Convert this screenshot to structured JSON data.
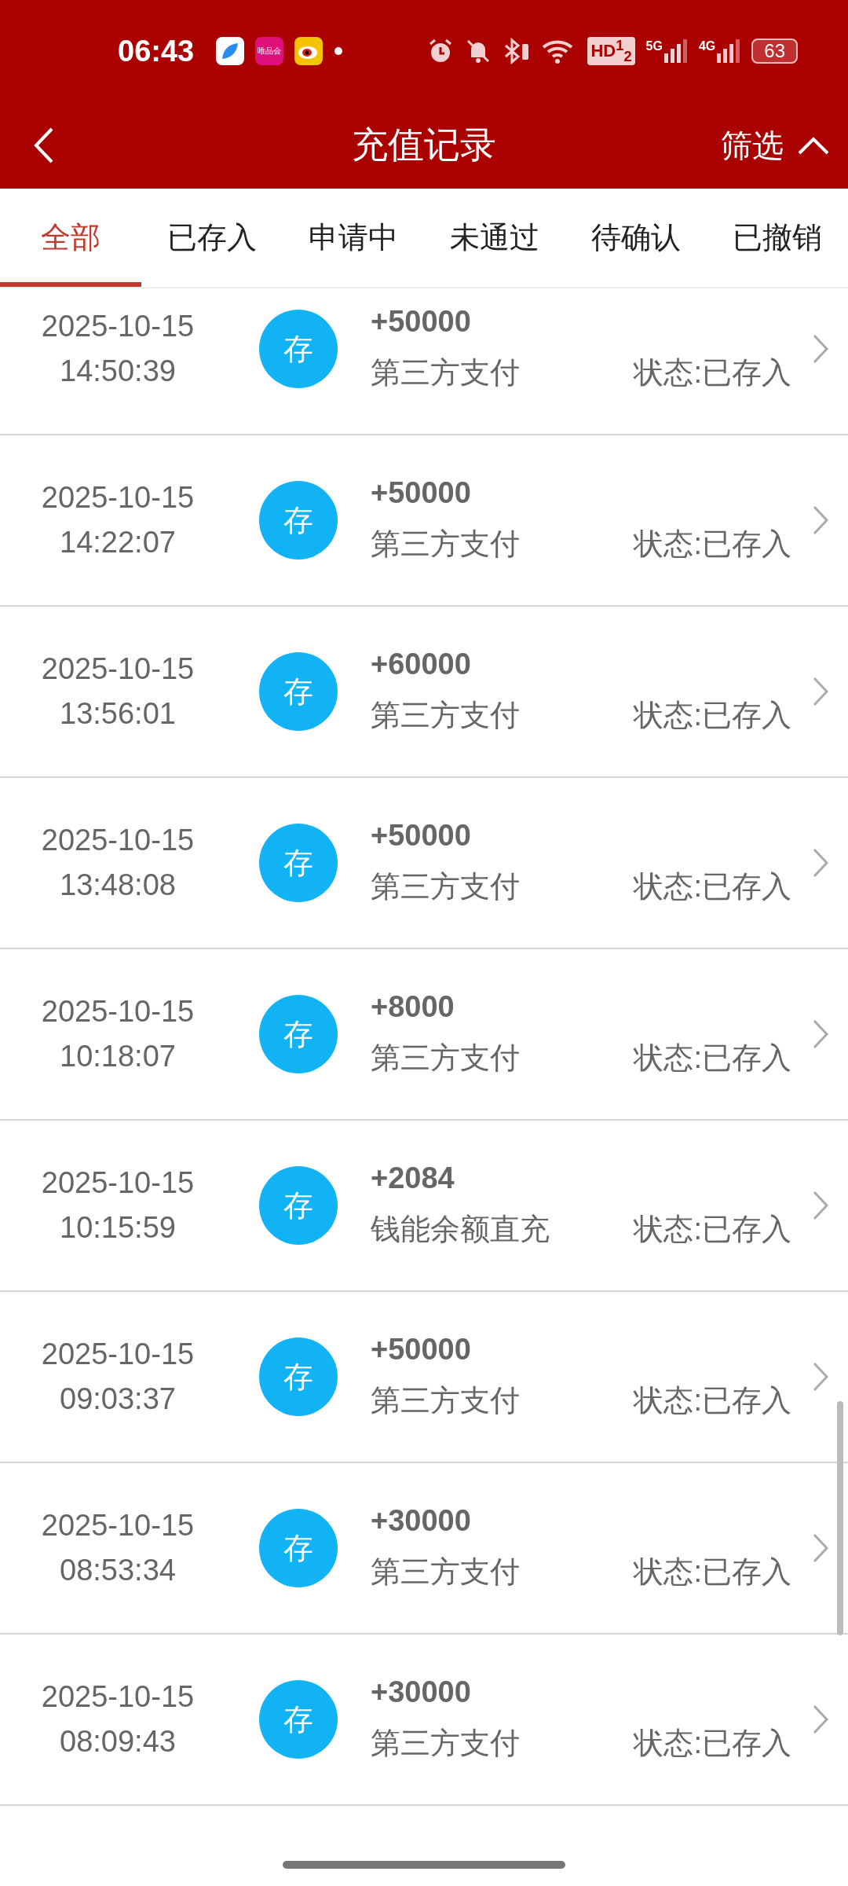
{
  "status_bar": {
    "time": "06:43",
    "app_label": "唯品会",
    "hd": "HD$^{1}$$_{2}$",
    "network_1": "5G",
    "network_2": "4G",
    "battery": "63"
  },
  "header": {
    "title": "充值记录",
    "filter": "筛选"
  },
  "tabs": [
    {
      "label": "全部",
      "selected": true
    },
    {
      "label": "已存入",
      "selected": false
    },
    {
      "label": "申请中",
      "selected": false
    },
    {
      "label": "未通过",
      "selected": false
    },
    {
      "label": "待确认",
      "selected": false
    },
    {
      "label": "已撤销",
      "selected": false
    }
  ],
  "records": [
    {
      "date": "2025-10-15",
      "time": "14:50:39",
      "badge": "存",
      "amount": "+50000",
      "method": "第三方支付",
      "status": "状态:已存入"
    },
    {
      "date": "2025-10-15",
      "time": "14:22:07",
      "badge": "存",
      "amount": "+50000",
      "method": "第三方支付",
      "status": "状态:已存入"
    },
    {
      "date": "2025-10-15",
      "time": "13:56:01",
      "badge": "存",
      "amount": "+60000",
      "method": "第三方支付",
      "status": "状态:已存入"
    },
    {
      "date": "2025-10-15",
      "time": "13:48:08",
      "badge": "存",
      "amount": "+50000",
      "method": "第三方支付",
      "status": "状态:已存入"
    },
    {
      "date": "2025-10-15",
      "time": "10:18:07",
      "badge": "存",
      "amount": "+8000",
      "method": "第三方支付",
      "status": "状态:已存入"
    },
    {
      "date": "2025-10-15",
      "time": "10:15:59",
      "badge": "存",
      "amount": "+2084",
      "method": "钱能余额直充",
      "status": "状态:已存入"
    },
    {
      "date": "2025-10-15",
      "time": "09:03:37",
      "badge": "存",
      "amount": "+50000",
      "method": "第三方支付",
      "status": "状态:已存入"
    },
    {
      "date": "2025-10-15",
      "time": "08:53:34",
      "badge": "存",
      "amount": "+30000",
      "method": "第三方支付",
      "status": "状态:已存入"
    },
    {
      "date": "2025-10-15",
      "time": "08:09:43",
      "badge": "存",
      "amount": "+30000",
      "method": "第三方支付",
      "status": "状态:已存入"
    }
  ]
}
